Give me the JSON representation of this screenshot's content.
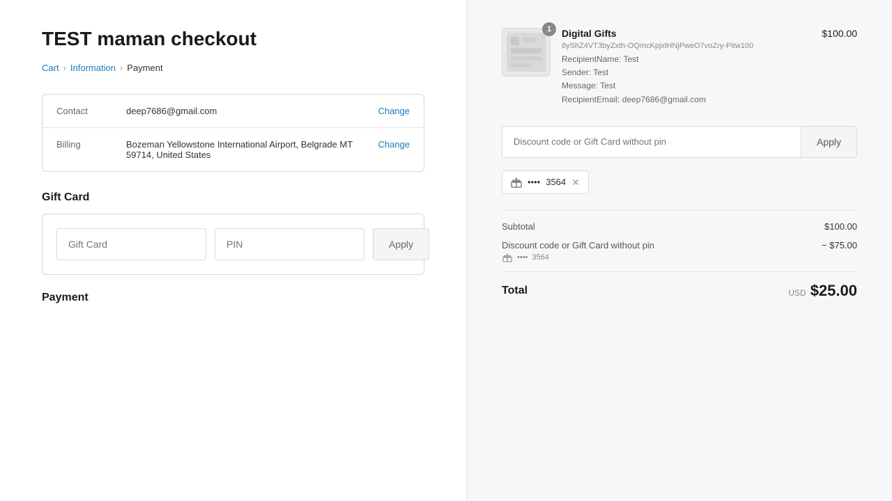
{
  "page": {
    "title": "TEST maman checkout"
  },
  "breadcrumb": {
    "cart": "Cart",
    "information": "Information",
    "current": "Payment"
  },
  "contact": {
    "label": "Contact",
    "value": "deep7686@gmail.com",
    "change_label": "Change"
  },
  "billing": {
    "label": "Billing",
    "value": "Bozeman Yellowstone International Airport, Belgrade MT 59714, United States",
    "change_label": "Change"
  },
  "gift_card_section": {
    "title": "Gift Card",
    "card_placeholder": "Gift Card",
    "pin_placeholder": "PIN",
    "apply_label": "Apply"
  },
  "payment_section": {
    "title": "Payment"
  },
  "right_panel": {
    "product": {
      "name": "Digital Gifts",
      "sku": "8yShZ4VT3byZxth-OQmcKpjxlHNjPweO7voZry-Pitw100",
      "recipient_name": "RecipientName: Test",
      "sender": "Sender: Test",
      "message": "Message: Test",
      "recipient_email": "RecipientEmail: deep7686@gmail.com",
      "price": "$100.00",
      "badge": "1"
    },
    "discount_input": {
      "placeholder": "Discount code or Gift Card without pin",
      "apply_label": "Apply"
    },
    "applied_tag": {
      "dots": "••••",
      "last4": "3564"
    },
    "subtotal": {
      "label": "Subtotal",
      "value": "$100.00"
    },
    "discount": {
      "label": "Discount code or Gift Card without pin",
      "dots": "••••",
      "last4": "3564",
      "value": "− $75.00"
    },
    "total": {
      "label": "Total",
      "currency": "USD",
      "value": "$25.00"
    }
  }
}
